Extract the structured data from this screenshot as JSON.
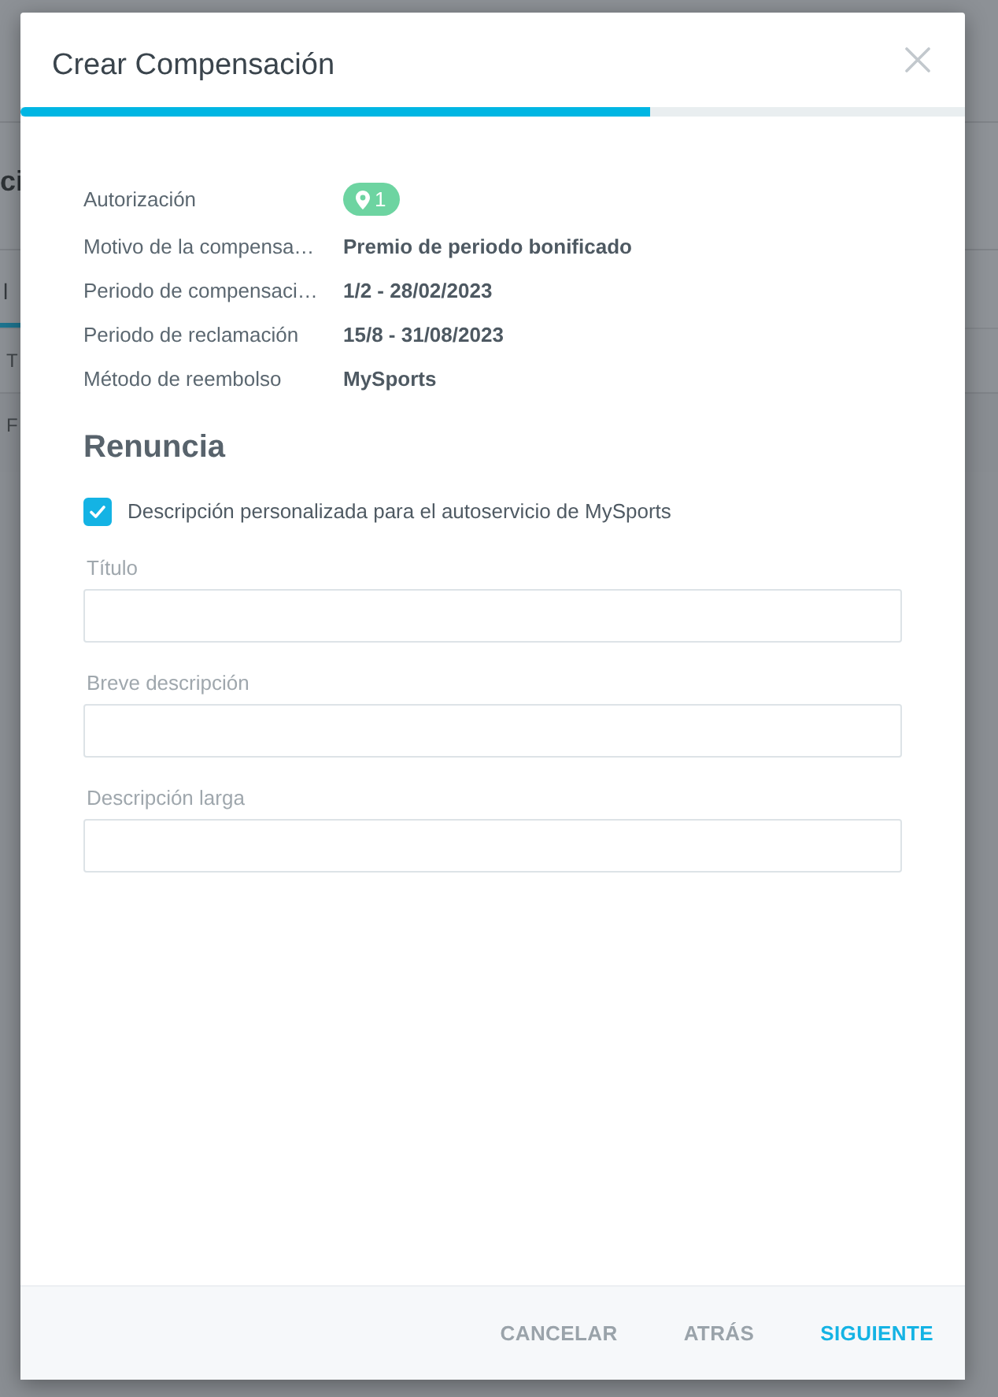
{
  "background_page": {
    "heading_fragment": "ci",
    "tab_fragment": "l",
    "column_fragment": "T",
    "row_fragment": "F"
  },
  "dialog": {
    "title": "Crear Compensación",
    "progress": {
      "level": 0.667
    }
  },
  "details": [
    {
      "label": "Autorización",
      "kind": "badge",
      "value": "1"
    },
    {
      "label": "Motivo de la compensa…",
      "kind": "text",
      "value": "Premio de periodo bonificado"
    },
    {
      "label": "Periodo de compensaci…",
      "kind": "text",
      "value": "1/2 - 28/02/2023"
    },
    {
      "label": "Periodo de reclamación",
      "kind": "text",
      "value": "15/8 - 31/08/2023"
    },
    {
      "label": "Método de reembolso",
      "kind": "text",
      "value": "MySports"
    }
  ],
  "renuncia": {
    "heading": "Renuncia",
    "checkbox": {
      "label": "Descripción personalizada para el autoservicio de MySports",
      "checked": true
    },
    "fields": [
      {
        "label": "Título"
      },
      {
        "label": "Breve descripción"
      },
      {
        "label": "Descripción larga"
      }
    ]
  },
  "footer": {
    "buttons": [
      {
        "label": "CANCELAR",
        "kind": "secondary"
      },
      {
        "label": "ATRÁS",
        "kind": "secondary"
      },
      {
        "label": "SIGUIENTE",
        "kind": "primary"
      }
    ]
  }
}
